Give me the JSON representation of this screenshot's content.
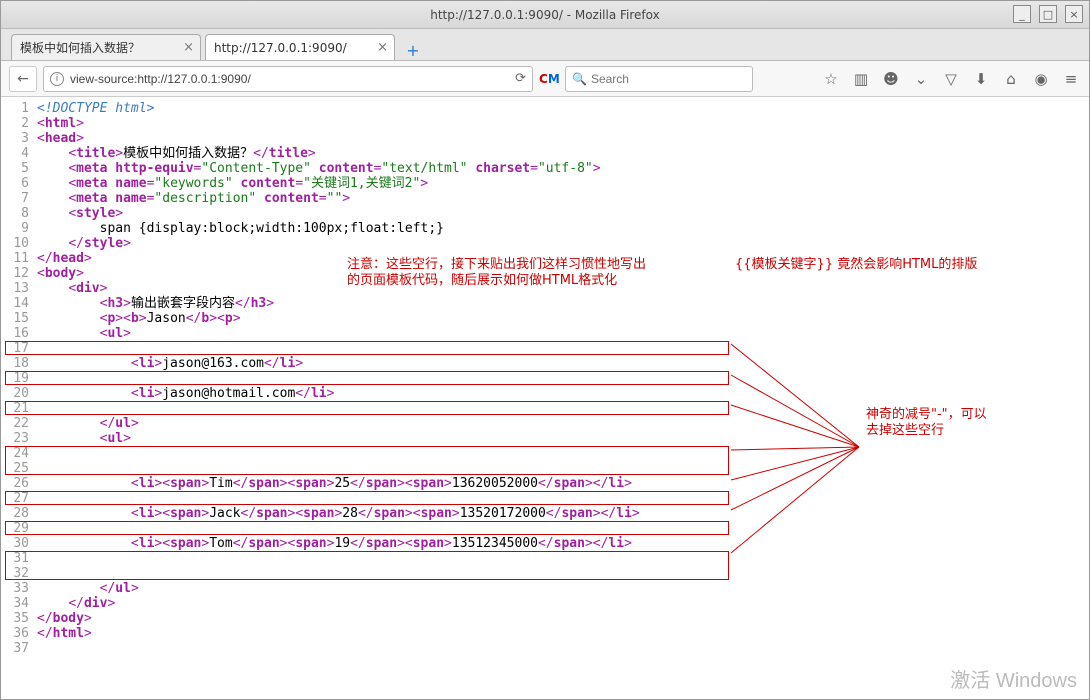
{
  "window": {
    "title": "http://127.0.0.1:9090/ - Mozilla Firefox"
  },
  "tabs": [
    {
      "label": "模板中如何插入数据？",
      "active": false
    },
    {
      "label": "http://127.0.0.1:9090/",
      "active": true
    }
  ],
  "url": "view-source:http://127.0.0.1:9090/",
  "search": {
    "placeholder": "Search"
  },
  "annotations": {
    "note1_line1": "注意：这些空行，接下来贴出我们这样习惯性地写出",
    "note1_line2": "的页面模板代码，随后展示如何做HTML格式化",
    "note2": "{{模板关键字}} 竟然会影响HTML的排版",
    "note3_line1": "神奇的减号\"-\"，可以",
    "note3_line2": "去掉这些空行"
  },
  "code": {
    "l1": {
      "doctype": "<!DOCTYPE html>"
    },
    "l2": {
      "o": "<",
      "t": "html",
      "c": ">"
    },
    "l3": {
      "o": "<",
      "t": "head",
      "c": ">"
    },
    "l4": {
      "indent": "    ",
      "o1": "<",
      "t1": "title",
      "c1": ">",
      "txt": "模板中如何插入数据？",
      "o2": "</",
      "t2": "title",
      "c2": ">"
    },
    "l5": {
      "indent": "    ",
      "o": "<",
      "t": "meta",
      "a1": " http-equiv",
      "eq1": "=",
      "v1": "\"Content-Type\"",
      "a2": " content",
      "eq2": "=",
      "v2": "\"text/html\"",
      "a3": " charset",
      "eq3": "=",
      "v3": "\"utf-8\"",
      "c": ">"
    },
    "l6": {
      "indent": "    ",
      "o": "<",
      "t": "meta",
      "a1": " name",
      "eq1": "=",
      "v1": "\"keywords\"",
      "a2": " content",
      "eq2": "=",
      "v2": "\"关键词1,关键词2\"",
      "c": ">"
    },
    "l7": {
      "indent": "    ",
      "o": "<",
      "t": "meta",
      "a1": " name",
      "eq1": "=",
      "v1": "\"description\"",
      "a2": " content",
      "eq2": "=",
      "v2": "\"\"",
      "c": ">"
    },
    "l8": {
      "indent": "    ",
      "o": "<",
      "t": "style",
      "c": ">"
    },
    "l9": {
      "txt": "        span {display:block;width:100px;float:left;}"
    },
    "l10": {
      "indent": "    ",
      "o": "</",
      "t": "style",
      "c": ">"
    },
    "l11": {
      "o": "</",
      "t": "head",
      "c": ">"
    },
    "l12": {
      "o": "<",
      "t": "body",
      "c": ">"
    },
    "l13": {
      "indent": "    ",
      "o": "<",
      "t": "div",
      "c": ">"
    },
    "l14": {
      "indent": "        ",
      "o1": "<",
      "t1": "h3",
      "c1": ">",
      "txt": "输出嵌套字段内容",
      "o2": "</",
      "t2": "h3",
      "c2": ">"
    },
    "l15": {
      "indent": "        ",
      "o1": "<",
      "t1": "p",
      "c1": ">",
      "o2": "<",
      "t2": "b",
      "c2": ">",
      "txt": "Jason",
      "o3": "</",
      "t3": "b",
      "c3": ">",
      "o4": "<",
      "t4": "p",
      "c4": ">"
    },
    "l16": {
      "indent": "        ",
      "o": "<",
      "t": "ul",
      "c": ">"
    },
    "l18": {
      "indent": "            ",
      "o1": "<",
      "t1": "li",
      "c1": ">",
      "txt": "jason@163.com",
      "o2": "</",
      "t2": "li",
      "c2": ">"
    },
    "l20": {
      "indent": "            ",
      "o1": "<",
      "t1": "li",
      "c1": ">",
      "txt": "jason@hotmail.com",
      "o2": "</",
      "t2": "li",
      "c2": ">"
    },
    "l22": {
      "indent": "        ",
      "o": "</",
      "t": "ul",
      "c": ">"
    },
    "l23": {
      "indent": "        ",
      "o": "<",
      "t": "ul",
      "c": ">"
    },
    "l26": {
      "indent": "            ",
      "li_o": "<",
      "li": "li",
      "li_c": ">",
      "sp_o": "<",
      "sp": "span",
      "sp_c": ">",
      "n1": "Tim",
      "n2": "25",
      "n3": "13620052000",
      "spc_o": "</",
      "spc_c": ">",
      "lic_o": "</",
      "lic_c": ">"
    },
    "l28": {
      "indent": "            ",
      "n1": "Jack",
      "n2": "28",
      "n3": "13520172000"
    },
    "l30": {
      "indent": "            ",
      "n1": "Tom",
      "n2": "19",
      "n3": "13512345000"
    },
    "l33": {
      "indent": "        ",
      "o": "</",
      "t": "ul",
      "c": ">"
    },
    "l34": {
      "indent": "    ",
      "o": "</",
      "t": "div",
      "c": ">"
    },
    "l35": {
      "o": "</",
      "t": "body",
      "c": ">"
    },
    "l36": {
      "o": "</",
      "t": "html",
      "c": ">"
    }
  },
  "watermark": "激活 Windows"
}
